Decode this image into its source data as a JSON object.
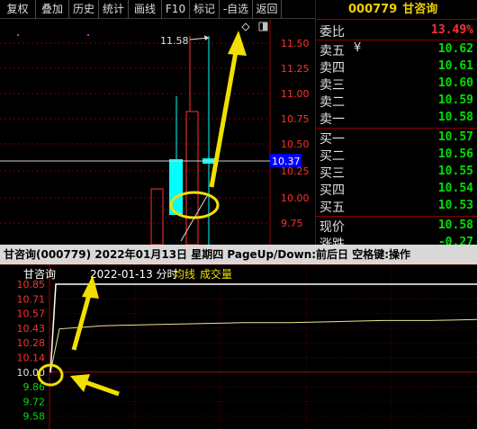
{
  "toolbar": {
    "items": [
      {
        "label": "复权"
      },
      {
        "label": "叠加"
      },
      {
        "label": "历史"
      },
      {
        "label": "统计"
      },
      {
        "label": "画线"
      },
      {
        "label": "F10"
      },
      {
        "label": "标记"
      },
      {
        "label": "-自选"
      },
      {
        "label": "返回"
      }
    ]
  },
  "kline": {
    "y_ticks": [
      "11.50",
      "11.25",
      "11.00",
      "10.75",
      "10.50",
      "10.25",
      "10.00",
      "9.75"
    ],
    "high_label": "11.58",
    "price_tag": "10.37"
  },
  "quote": {
    "code": "000779",
    "name": "甘咨询",
    "weibi_label": "委比",
    "weibi_value": "13.49%",
    "sell": [
      {
        "label": "卖五",
        "value": "10.62"
      },
      {
        "label": "卖四",
        "value": "10.61"
      },
      {
        "label": "卖三",
        "value": "10.60"
      },
      {
        "label": "卖二",
        "value": "10.59"
      },
      {
        "label": "卖一",
        "value": "10.58"
      }
    ],
    "buy": [
      {
        "label": "买一",
        "value": "10.57"
      },
      {
        "label": "买二",
        "value": "10.56"
      },
      {
        "label": "买三",
        "value": "10.55"
      },
      {
        "label": "买四",
        "value": "10.54"
      },
      {
        "label": "买五",
        "value": "10.53"
      }
    ],
    "current_label": "现价",
    "current_value": "10.58",
    "change_label": "涨跌",
    "change_value": "-0.27"
  },
  "status": {
    "text": "甘咨询(000779)  2022年01月13日 星期四 PageUp/Down:前后日 空格键:操作"
  },
  "timechart": {
    "name": "甘咨询",
    "date_label": "2022-01-13 分时",
    "avg_label": "均线",
    "vol_label": "成交量",
    "y_ticks": [
      "10.85",
      "10.71",
      "10.57",
      "10.43",
      "10.28",
      "10.14",
      "10.00",
      "9.86",
      "9.72",
      "9.58"
    ],
    "y_min": 9.58,
    "y_max": 10.85,
    "price_series": [
      10.0,
      10.85,
      10.85,
      10.85,
      10.85,
      10.85,
      10.85,
      10.85,
      10.85,
      10.85,
      10.85
    ],
    "avg_series": [
      10.0,
      10.42,
      10.45,
      10.46,
      10.47,
      10.48,
      10.48,
      10.49,
      10.5,
      10.5,
      10.51
    ]
  },
  "colors": {
    "grid_red": "#7a0000",
    "axis_red": "#ff3030",
    "cyan": "#00ffff",
    "yellow": "#f0e000",
    "price_line": "#ffffff",
    "avg_line": "#e8e890",
    "green": "#00e000",
    "blue_tag": "#0000ff"
  }
}
